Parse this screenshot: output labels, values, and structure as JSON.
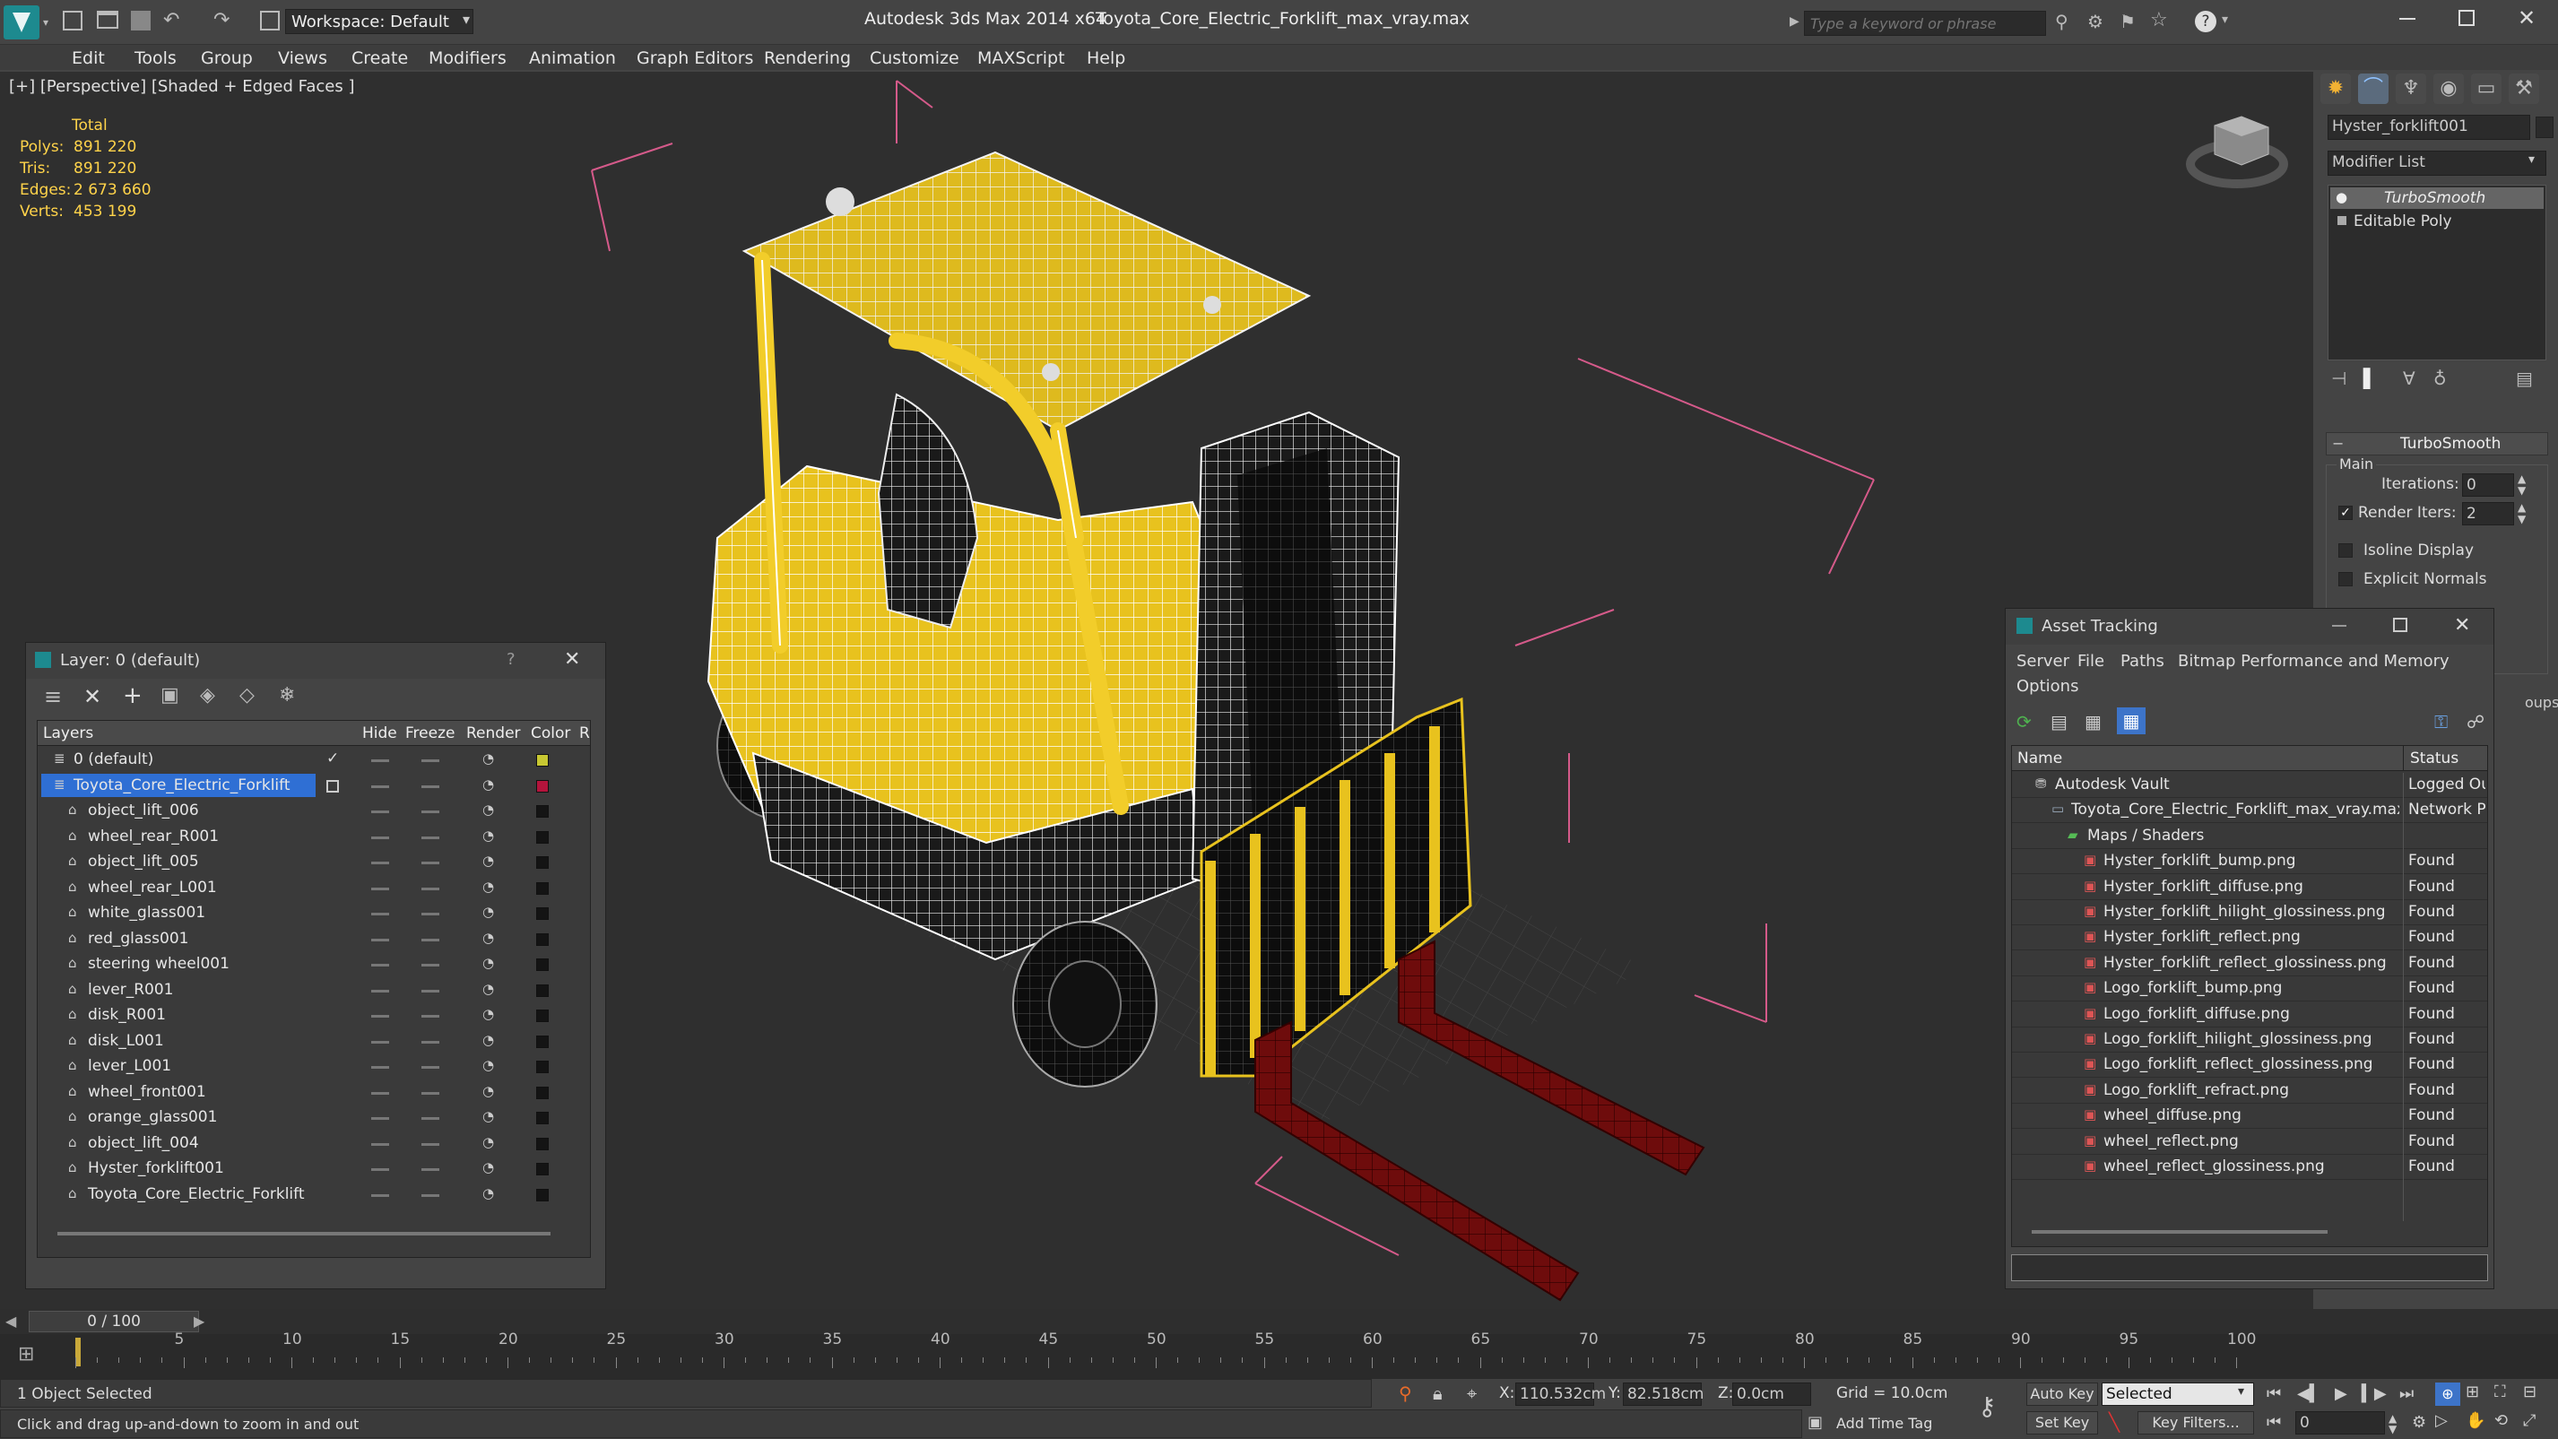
{
  "titlebar": {
    "workspace_label": "Workspace: Default",
    "app_title": "Autodesk 3ds Max  2014 x64",
    "file_title": "Toyota_Core_Electric_Forklift_max_vray.max",
    "search_placeholder": "Type a keyword or phrase"
  },
  "menu": [
    "Edit",
    "Tools",
    "Group",
    "Views",
    "Create",
    "Modifiers",
    "Animation",
    "Graph Editors",
    "Rendering",
    "Customize",
    "MAXScript",
    "Help"
  ],
  "viewport": {
    "label": "[+] [Perspective] [Shaded + Edged Faces ]",
    "stats_header": "Total",
    "stats": [
      {
        "label": "Polys:",
        "value": "891 220"
      },
      {
        "label": "Tris:",
        "value": "891 220"
      },
      {
        "label": "Edges:",
        "value": "2 673 660"
      },
      {
        "label": "Verts:",
        "value": "453 199"
      }
    ]
  },
  "command_panel": {
    "object_name": "Hyster_forklift001",
    "modifier_list": "Modifier List",
    "stack": [
      "TurboSmooth",
      "Editable Poly"
    ],
    "rollout_title": "TurboSmooth",
    "group_main": "Main",
    "iterations_label": "Iterations:",
    "iterations_value": "0",
    "render_iters_label": "Render Iters:",
    "render_iters_value": "2",
    "isoline_label": "Isoline Display",
    "explicit_normals_label": "Explicit Normals",
    "partial_label": "oups"
  },
  "layer_dialog": {
    "title": "Layer: 0 (default)",
    "help": "?",
    "columns": [
      "Layers",
      "Hide",
      "Freeze",
      "Render",
      "Color",
      "R"
    ],
    "rows": [
      {
        "name": "0 (default)",
        "level": 1,
        "color": "#c8c832",
        "check": true
      },
      {
        "name": "Toyota_Core_Electric_Forklift",
        "level": 1,
        "color": "#b4143c",
        "selected": true
      },
      {
        "name": "object_lift_006",
        "level": 2,
        "color": "#141414"
      },
      {
        "name": "wheel_rear_R001",
        "level": 2,
        "color": "#141414"
      },
      {
        "name": "object_lift_005",
        "level": 2,
        "color": "#141414"
      },
      {
        "name": "wheel_rear_L001",
        "level": 2,
        "color": "#141414"
      },
      {
        "name": "white_glass001",
        "level": 2,
        "color": "#141414"
      },
      {
        "name": "red_glass001",
        "level": 2,
        "color": "#141414"
      },
      {
        "name": "steering wheel001",
        "level": 2,
        "color": "#141414"
      },
      {
        "name": "lever_R001",
        "level": 2,
        "color": "#141414"
      },
      {
        "name": "disk_R001",
        "level": 2,
        "color": "#141414"
      },
      {
        "name": "disk_L001",
        "level": 2,
        "color": "#141414"
      },
      {
        "name": "lever_L001",
        "level": 2,
        "color": "#141414"
      },
      {
        "name": "wheel_front001",
        "level": 2,
        "color": "#141414"
      },
      {
        "name": "orange_glass001",
        "level": 2,
        "color": "#141414"
      },
      {
        "name": "object_lift_004",
        "level": 2,
        "color": "#141414"
      },
      {
        "name": "Hyster_forklift001",
        "level": 2,
        "color": "#141414"
      },
      {
        "name": "Toyota_Core_Electric_Forklift",
        "level": 2,
        "color": "#141414"
      }
    ]
  },
  "asset_dialog": {
    "title": "Asset Tracking",
    "menu": [
      "Server",
      "File",
      "Paths",
      "Bitmap Performance and Memory",
      "Options"
    ],
    "col_name": "Name",
    "col_status": "Status",
    "rows": [
      {
        "name": "Autodesk Vault",
        "status": "Logged Ou",
        "indent": 1,
        "kind": "vault"
      },
      {
        "name": "Toyota_Core_Electric_Forklift_max_vray.max",
        "status": "Network P",
        "indent": 2,
        "kind": "file"
      },
      {
        "name": "Maps / Shaders",
        "status": "",
        "indent": 3,
        "kind": "folder"
      },
      {
        "name": "Hyster_forklift_bump.png",
        "status": "Found",
        "indent": 4,
        "kind": "png"
      },
      {
        "name": "Hyster_forklift_diffuse.png",
        "status": "Found",
        "indent": 4,
        "kind": "png"
      },
      {
        "name": "Hyster_forklift_hilight_glossiness.png",
        "status": "Found",
        "indent": 4,
        "kind": "png"
      },
      {
        "name": "Hyster_forklift_reflect.png",
        "status": "Found",
        "indent": 4,
        "kind": "png"
      },
      {
        "name": "Hyster_forklift_reflect_glossiness.png",
        "status": "Found",
        "indent": 4,
        "kind": "png"
      },
      {
        "name": "Logo_forklift_bump.png",
        "status": "Found",
        "indent": 4,
        "kind": "png"
      },
      {
        "name": "Logo_forklift_diffuse.png",
        "status": "Found",
        "indent": 4,
        "kind": "png"
      },
      {
        "name": "Logo_forklift_hilight_glossiness.png",
        "status": "Found",
        "indent": 4,
        "kind": "png"
      },
      {
        "name": "Logo_forklift_reflect_glossiness.png",
        "status": "Found",
        "indent": 4,
        "kind": "png"
      },
      {
        "name": "Logo_forklift_refract.png",
        "status": "Found",
        "indent": 4,
        "kind": "png"
      },
      {
        "name": "wheel_diffuse.png",
        "status": "Found",
        "indent": 4,
        "kind": "png"
      },
      {
        "name": "wheel_reflect.png",
        "status": "Found",
        "indent": 4,
        "kind": "png"
      },
      {
        "name": "wheel_reflect_glossiness.png",
        "status": "Found",
        "indent": 4,
        "kind": "png"
      }
    ]
  },
  "timeline": {
    "frame_label": "0 / 100",
    "ticks": [
      "5",
      "10",
      "15",
      "20",
      "25",
      "30",
      "35",
      "40",
      "45",
      "50",
      "55",
      "60",
      "65",
      "70",
      "75",
      "80",
      "85",
      "90",
      "95",
      "100"
    ]
  },
  "statusbar": {
    "selection": "1 Object Selected",
    "prompt": "Click and drag up-and-down to zoom in and out",
    "x_label": "X:",
    "x_value": "110.532cm",
    "y_label": "Y:",
    "y_value": "82.518cm",
    "z_label": "Z:",
    "z_value": "0.0cm",
    "grid": "Grid = 10.0cm",
    "add_time_tag": "Add Time Tag",
    "auto_key": "Auto Key",
    "selected_dropdown": "Selected",
    "set_key": "Set Key",
    "key_filters": "Key Filters...",
    "frame_value": "0"
  },
  "colors": {
    "wire_yellow": "#e8c21e",
    "fork_red": "#8a1010",
    "bbox_pink": "#d55a8a",
    "selection_blue": "#2f6fd4",
    "stat_yellow": "#ffd34a"
  }
}
